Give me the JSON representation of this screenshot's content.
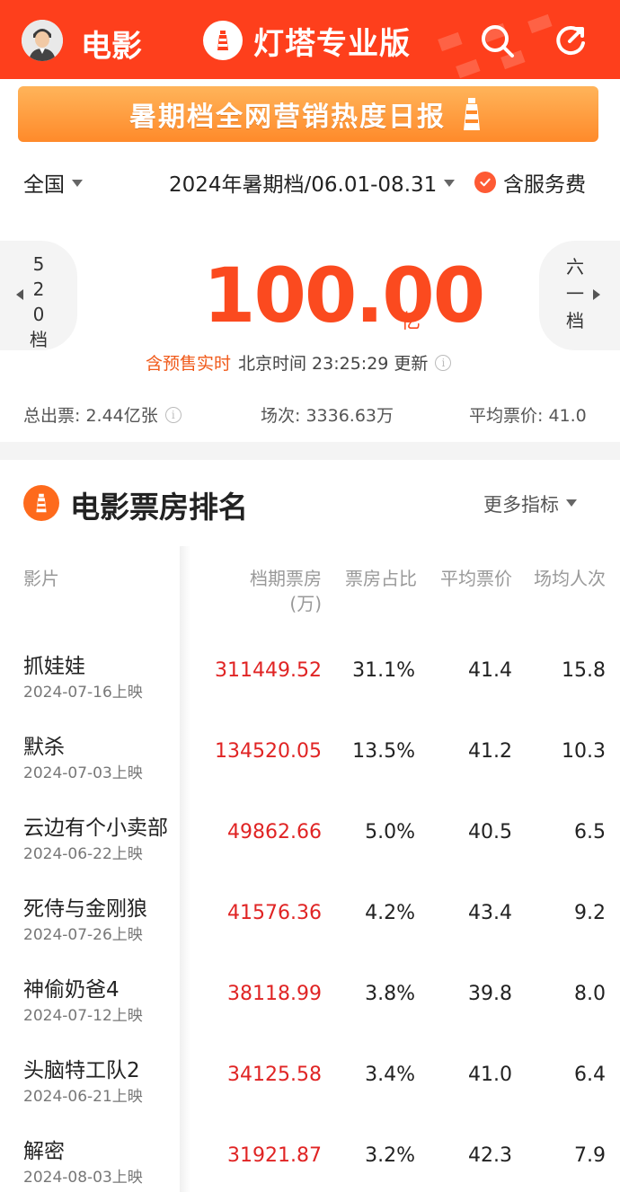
{
  "header": {
    "title": "电影",
    "brand": "灯塔专业版",
    "accent_color": "#fe3f1c",
    "icons": [
      "avatar",
      "lighthouse-logo-icon",
      "search-icon",
      "refresh-icon"
    ]
  },
  "banner": {
    "text": "暑期档全网营销热度日报"
  },
  "filters": {
    "region": "全国",
    "period": "2024年暑期档/06.01-08.31",
    "service_fee": "含服务费"
  },
  "nav": {
    "prev": "520档",
    "next": "六一档"
  },
  "summary": {
    "box_office": "100.00",
    "unit": "亿",
    "realtime_label": "含预售实时",
    "update_text": "北京时间 23:25:29 更新",
    "total_tickets": "总出票: 2.44亿张",
    "shows": "场次: 3336.63万",
    "avg_price": "平均票价: 41.0"
  },
  "section": {
    "title": "电影票房排名",
    "more": "更多指标"
  },
  "table": {
    "headers": {
      "name": "影片",
      "box_office_1": "档期票房",
      "box_office_2": "(万)",
      "share": "票房占比",
      "price": "平均票价",
      "avg_people": "场均人次"
    },
    "rows": [
      {
        "name": "抓娃娃",
        "date": "2024-07-16上映",
        "bo": "311449.52",
        "share": "31.1%",
        "price": "41.4",
        "avg": "15.8"
      },
      {
        "name": "默杀",
        "date": "2024-07-03上映",
        "bo": "134520.05",
        "share": "13.5%",
        "price": "41.2",
        "avg": "10.3"
      },
      {
        "name": "云边有个小卖部",
        "date": "2024-06-22上映",
        "bo": "49862.66",
        "share": "5.0%",
        "price": "40.5",
        "avg": "6.5"
      },
      {
        "name": "死侍与金刚狼",
        "date": "2024-07-26上映",
        "bo": "41576.36",
        "share": "4.2%",
        "price": "43.4",
        "avg": "9.2"
      },
      {
        "name": "神偷奶爸4",
        "date": "2024-07-12上映",
        "bo": "38118.99",
        "share": "3.8%",
        "price": "39.8",
        "avg": "8.0"
      },
      {
        "name": "头脑特工队2",
        "date": "2024-06-21上映",
        "bo": "34125.58",
        "share": "3.4%",
        "price": "41.0",
        "avg": "6.4"
      },
      {
        "name": "解密",
        "date": "2024-08-03上映",
        "bo": "31921.87",
        "share": "3.2%",
        "price": "42.3",
        "avg": "7.9"
      }
    ]
  }
}
